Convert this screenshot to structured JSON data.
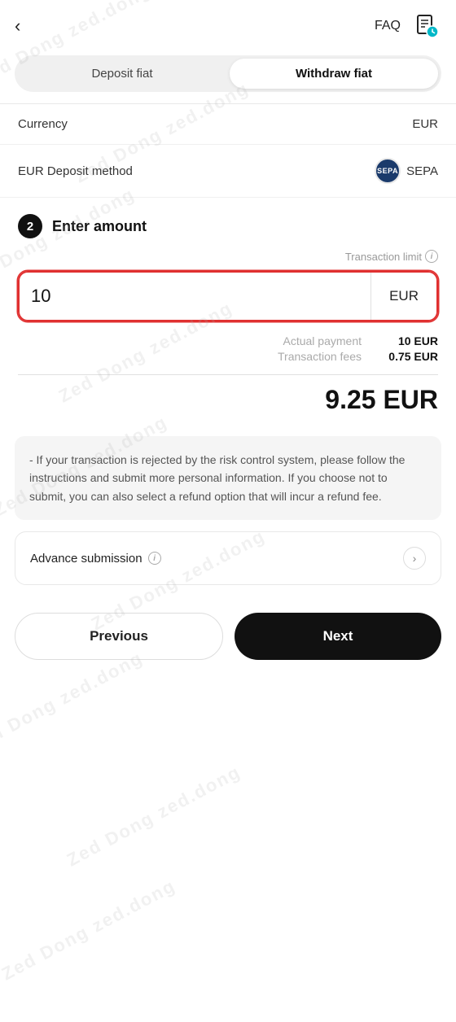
{
  "header": {
    "faq_label": "FAQ",
    "back_icon": "‹"
  },
  "tabs": {
    "items": [
      {
        "label": "Deposit fiat",
        "active": false
      },
      {
        "label": "Withdraw fiat",
        "active": true
      }
    ]
  },
  "info_rows": [
    {
      "label": "Currency",
      "value": "EUR",
      "has_badge": false
    },
    {
      "label": "EUR Deposit method",
      "value": "SEPA",
      "has_badge": true
    }
  ],
  "enter_amount": {
    "step": "2",
    "title": "Enter amount",
    "transaction_limit_label": "Transaction limit",
    "amount_value": "10",
    "currency": "EUR",
    "actual_payment_label": "Actual payment",
    "actual_payment_value": "10 EUR",
    "transaction_fees_label": "Transaction fees",
    "transaction_fees_value": "0.75 EUR",
    "total_amount": "9.25 EUR"
  },
  "info_box": {
    "text": "- If your transaction is rejected by the risk control system, please follow the instructions and submit more personal information. If you choose not to submit, you can also select a refund option that will incur a refund fee."
  },
  "advance_submission": {
    "label": "Advance submission"
  },
  "buttons": {
    "previous": "Previous",
    "next": "Next"
  },
  "watermark": "Zed Dong zed.dong"
}
